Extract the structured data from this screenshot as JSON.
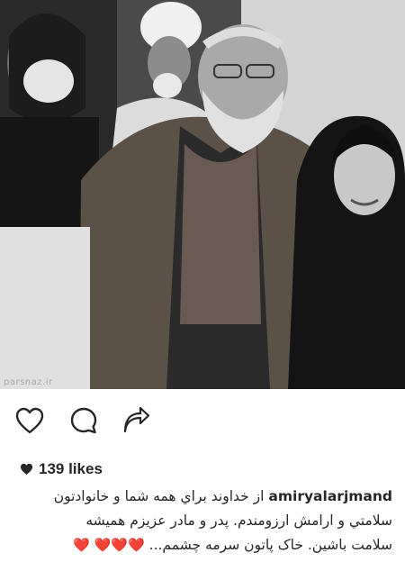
{
  "post": {
    "image_alt": "black and white photo",
    "watermark": "parsnaz.ir"
  },
  "actions": {
    "like_icon": "heart-outline-icon",
    "comment_icon": "comment-bubble-icon",
    "share_icon": "share-arrow-icon"
  },
  "likes": {
    "heart_icon": "heart-filled-icon",
    "text": "139 likes"
  },
  "caption": {
    "username": "amiryalarjmand",
    "line1_text": "از خداوند براي همه شما و خانوادتون",
    "line2_text": "سلامتي و ارامش ارزومندم. پدر و مادر عزیزم  همیشه",
    "line3_text": "سلامت باشین. خاک پاتون  سرمه چشمم...",
    "line3_hearts": "❤️❤️❤️ ❤️"
  },
  "colors": {
    "text": "#262626",
    "heart": "#e0245e"
  }
}
